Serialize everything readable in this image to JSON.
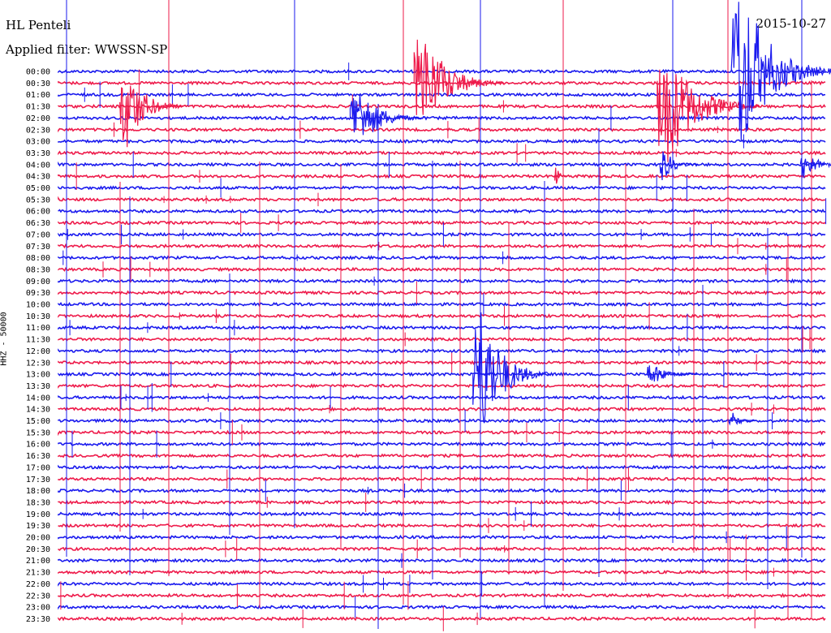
{
  "header": {
    "station": "HL Penteli",
    "filter": "Applied filter: WWSSN-SP",
    "date": "2015-10-27"
  },
  "colors": {
    "a": "#1a1aee",
    "b": "#ee1a4a"
  },
  "chart_data": {
    "type": "line",
    "title": "",
    "xlabel": "",
    "ylabel": "HHZ - 50000",
    "xlim_minutes": [
      0,
      30
    ],
    "rows": [
      "00:00",
      "00:30",
      "01:00",
      "01:30",
      "02:00",
      "02:30",
      "03:00",
      "03:30",
      "04:00",
      "04:30",
      "05:00",
      "05:30",
      "06:00",
      "06:30",
      "07:00",
      "07:30",
      "08:00",
      "08:30",
      "09:00",
      "09:30",
      "10:00",
      "10:30",
      "11:00",
      "11:30",
      "12:00",
      "12:30",
      "13:00",
      "13:30",
      "14:00",
      "14:30",
      "15:00",
      "15:30",
      "16:00",
      "16:30",
      "17:00",
      "17:30",
      "18:00",
      "18:30",
      "19:00",
      "19:30",
      "20:00",
      "20:30",
      "21:00",
      "21:30",
      "22:00",
      "22:30",
      "23:00",
      "23:30"
    ],
    "series_colors": [
      "blue",
      "red"
    ],
    "events": [
      {
        "row": 3,
        "minute": 2.4,
        "amplitude": 80,
        "duration": 2.5,
        "color": "red"
      },
      {
        "row": 4,
        "minute": 11.4,
        "amplitude": 60,
        "duration": 3,
        "color": "blue"
      },
      {
        "row": 1,
        "minute": 13.9,
        "amplitude": 95,
        "duration": 3.5,
        "color": "red"
      },
      {
        "row": 3,
        "minute": 23.4,
        "amplitude": 110,
        "duration": 4,
        "color": "red"
      },
      {
        "row": 0,
        "minute": 26.3,
        "amplitude": 160,
        "duration": 4,
        "color": "blue"
      },
      {
        "row": 8,
        "minute": 23.5,
        "amplitude": 30,
        "duration": 1.5,
        "color": "blue"
      },
      {
        "row": 9,
        "minute": 19.4,
        "amplitude": 20,
        "duration": 0.5,
        "color": "red"
      },
      {
        "row": 8,
        "minute": 29.0,
        "amplitude": 25,
        "duration": 2,
        "color": "blue"
      },
      {
        "row": 26,
        "minute": 16.2,
        "amplitude": 130,
        "duration": 3,
        "color": "blue"
      },
      {
        "row": 26,
        "minute": 23.0,
        "amplitude": 22,
        "duration": 2,
        "color": "blue"
      },
      {
        "row": 30,
        "minute": 26.2,
        "amplitude": 20,
        "duration": 1,
        "color": "blue"
      }
    ]
  }
}
